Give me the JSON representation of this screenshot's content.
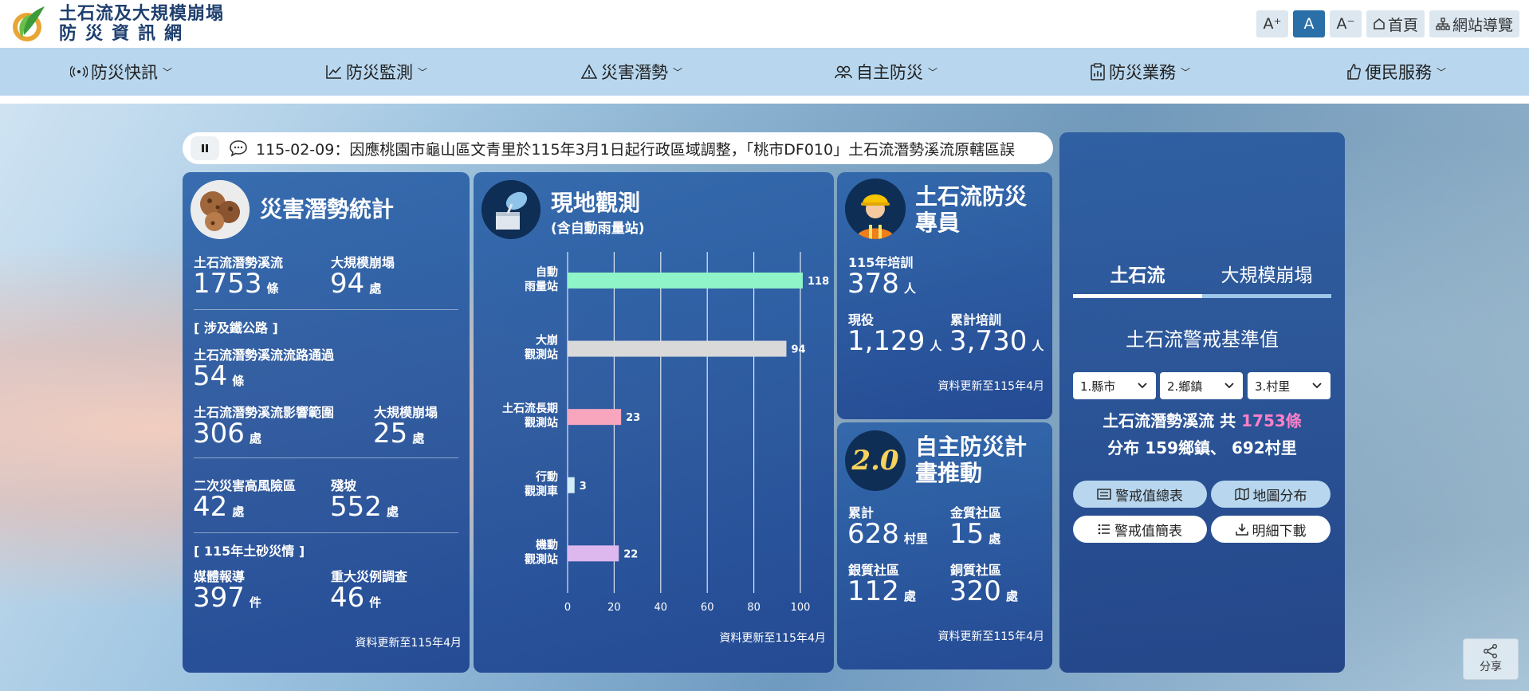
{
  "site": {
    "title_line1": "土石流及大規模崩塌",
    "title_line2": "防災資訊網"
  },
  "tools": {
    "font_large": "A⁺",
    "font_medium": "A",
    "font_small": "A⁻",
    "home": "首頁",
    "sitemap": "網站導覽"
  },
  "nav": [
    {
      "label": "防災快訊",
      "icon": "broadcast-icon"
    },
    {
      "label": "防災監測",
      "icon": "trend-chart-icon"
    },
    {
      "label": "災害潛勢",
      "icon": "warning-icon"
    },
    {
      "label": "自主防災",
      "icon": "people-icon"
    },
    {
      "label": "防災業務",
      "icon": "clipboard-icon"
    },
    {
      "label": "便民服務",
      "icon": "thumbs-up-icon"
    }
  ],
  "ticker": {
    "text": "115-02-09：因應桃園市龜山區文青里於115年3月1日起行政區域調整，「桃市DF010」土石流潛勢溪流原轄區誤"
  },
  "potential": {
    "title": "災害潛勢統計",
    "debris_label": "土石流潛勢溪流",
    "debris_value": "1753",
    "debris_unit": "條",
    "landslide_label": "大規模崩塌",
    "landslide_value": "94",
    "landslide_unit": "處",
    "rail_section": "[ 涉及鐵公路 ]",
    "road_label": "土石流潛勢溪流流路通過",
    "road_value": "54",
    "road_unit": "條",
    "impact_label": "土石流潛勢溪流影響範圍",
    "impact_value": "306",
    "impact_unit": "處",
    "landslide2_label": "大規模崩塌",
    "landslide2_value": "25",
    "landslide2_unit": "處",
    "secondary_label": "二次災害高風險區",
    "secondary_value": "42",
    "secondary_unit": "處",
    "slope_label": "殘坡",
    "slope_value": "552",
    "slope_unit": "處",
    "year_section": "[ 115年土砂災情 ]",
    "media_label": "媒體報導",
    "media_value": "397",
    "media_unit": "件",
    "survey_label": "重大災例調查",
    "survey_value": "46",
    "survey_unit": "件",
    "updated": "資料更新至115年4月"
  },
  "observation": {
    "title": "現地觀測",
    "subtitle": "(含自動雨量站)",
    "updated": "資料更新至115年4月"
  },
  "chart_data": {
    "type": "bar",
    "orientation": "horizontal",
    "categories": [
      "自動\n雨量站",
      "大崩\n觀測站",
      "土石流長期\n觀測站",
      "行動\n觀測車",
      "機動\n觀測站"
    ],
    "values": [
      118,
      94,
      23,
      3,
      22
    ],
    "colors": [
      "#8ff5c8",
      "#d9d9d9",
      "#f7a6bd",
      "#d0ecf8",
      "#ddb8ee"
    ],
    "xticks": [
      0,
      20,
      40,
      60,
      80,
      100
    ],
    "xlim": [
      0,
      100
    ],
    "grid": true
  },
  "specialist": {
    "title_line1": "土石流防災",
    "title_line2": "專員",
    "trained_label": "115年培訓",
    "trained_value": "378",
    "trained_unit": "人",
    "active_label": "現役",
    "active_value": "1,129",
    "active_unit": "人",
    "total_label": "累計培訓",
    "total_value": "3,730",
    "total_unit": "人",
    "updated": "資料更新至115年4月"
  },
  "plan": {
    "badge": "2.0",
    "title_line1": "自主防災計",
    "title_line2": "畫推動",
    "total_label": "累計",
    "total_value": "628",
    "total_unit": "村里",
    "gold_label": "金質社區",
    "gold_value": "15",
    "gold_unit": "處",
    "silver_label": "銀質社區",
    "silver_value": "112",
    "silver_unit": "處",
    "bronze_label": "銅質社區",
    "bronze_value": "320",
    "bronze_unit": "處",
    "updated": "資料更新至115年4月"
  },
  "warning": {
    "tab1": "土石流",
    "tab2": "大規模崩塌",
    "heading": "土石流警戒基準值",
    "select_county": "1.縣市",
    "select_town": "2.鄉鎮",
    "select_village": "3.村里",
    "summary_prefix": "土石流潛勢溪流 共 ",
    "summary_count": "1753條",
    "summary_line2": "分布 159鄉鎮、 692村里",
    "btn_table": "警戒值總表",
    "btn_map": "地圖分布",
    "btn_brief": "警戒值簡表",
    "btn_download": "明細下載",
    "accent": "#ff7fc8"
  },
  "share": {
    "label": "分享"
  }
}
